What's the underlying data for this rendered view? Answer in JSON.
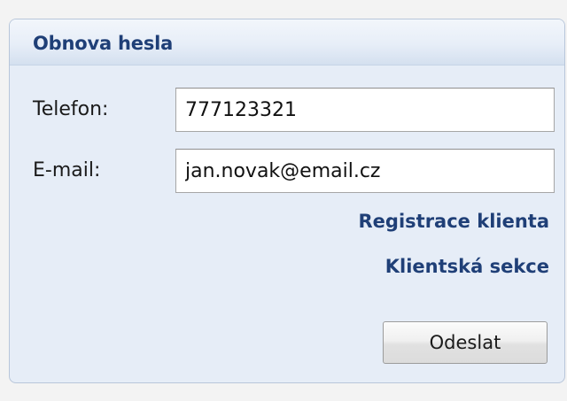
{
  "panel": {
    "title": "Obnova hesla"
  },
  "form": {
    "phone": {
      "label": "Telefon:",
      "value": "777123321"
    },
    "email": {
      "label": "E-mail:",
      "value": "jan.novak@email.cz"
    },
    "submit_label": "Odeslat"
  },
  "links": {
    "register": "Registrace klienta",
    "client_section": "Klientská sekce"
  },
  "colors": {
    "title": "#1f3f77",
    "panel_background": "#e6edf7",
    "link": "#1f3f77"
  }
}
